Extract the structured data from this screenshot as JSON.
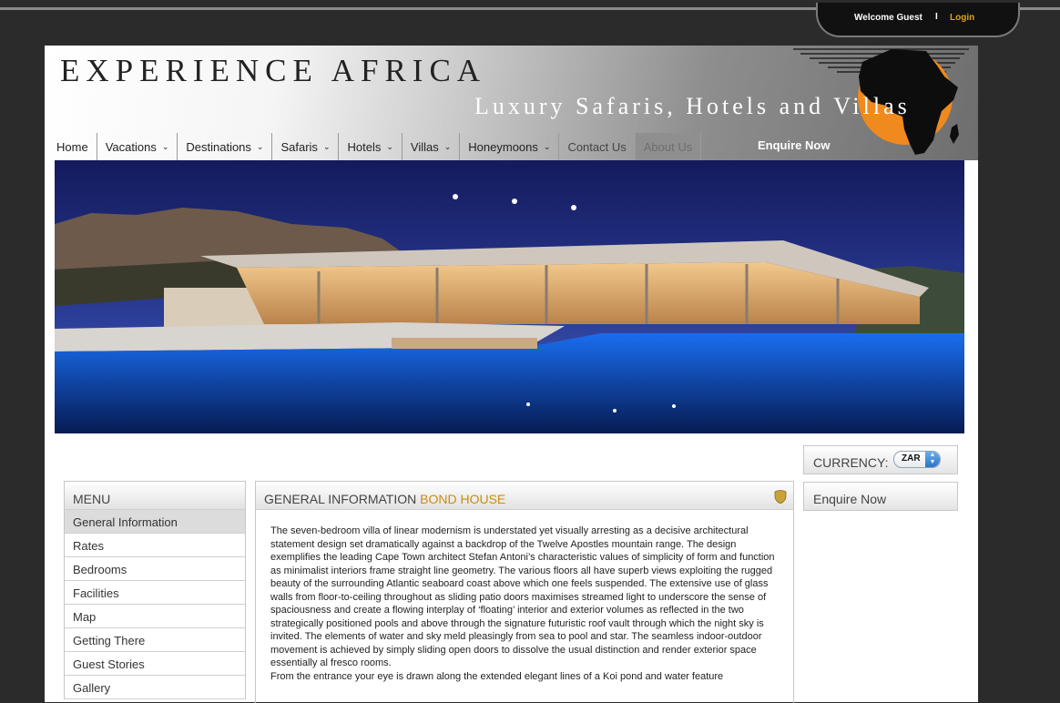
{
  "account": {
    "welcome": "Welcome Guest",
    "separator": "I",
    "login": "Login"
  },
  "header": {
    "title": "EXPERIENCE AFRICA",
    "tagline": "Luxury Safaris, Hotels and Villas"
  },
  "nav": {
    "items": [
      {
        "label": "Home",
        "dropdown": false
      },
      {
        "label": "Vacations",
        "dropdown": true
      },
      {
        "label": "Destinations",
        "dropdown": true
      },
      {
        "label": "Safaris",
        "dropdown": true
      },
      {
        "label": "Hotels",
        "dropdown": true
      },
      {
        "label": "Villas",
        "dropdown": true
      },
      {
        "label": "Honeymoons",
        "dropdown": true
      },
      {
        "label": "Contact Us",
        "dropdown": false
      },
      {
        "label": "About Us",
        "dropdown": false
      }
    ],
    "enquire": "Enquire Now"
  },
  "sidebar_right": {
    "currency_label": "CURRENCY:",
    "currency_value": "ZAR",
    "enquire_label": "Enquire Now"
  },
  "menu": {
    "title": "MENU",
    "items": [
      "General Information",
      "Rates",
      "Bedrooms",
      "Facilities",
      "Map",
      "Getting There",
      "Guest Stories",
      "Gallery"
    ],
    "active_index": 0
  },
  "content": {
    "heading": "GENERAL INFORMATION",
    "heading_highlight": "BOND HOUSE",
    "paragraphs": [
      "The seven-bedroom villa of linear modernism is understated yet visually arresting as a decisive architectural statement design set dramatically against a backdrop of the Twelve Apostles mountain range. The design exemplifies the leading Cape Town architect Stefan Antoni’s characteristic values of simplicity of form and function as minimalist interiors frame straight line geometry. The various floors all have superb views exploiting the rugged beauty of the surrounding Atlantic seaboard coast above which one feels suspended. The extensive use of glass walls from floor-to-ceiling throughout as sliding patio doors maximises streamed light to underscore the sense of spaciousness and create a flowing interplay of ‘floating’ interior and exterior volumes as reflected in the two strategically positioned pools and above through the signature futuristic roof vault through which the night sky is invited. The elements of water and sky meld pleasingly from sea to pool and star. The seamless indoor-outdoor movement is achieved by simply sliding open doors to dissolve the usual distinction and render exterior space essentially al fresco rooms.",
      "From the entrance your eye is drawn along the extended elegant lines of a Koi pond and water feature"
    ]
  },
  "colors": {
    "accent": "#c98d12",
    "login": "#e0a21a",
    "background": "#2b2b2b"
  }
}
